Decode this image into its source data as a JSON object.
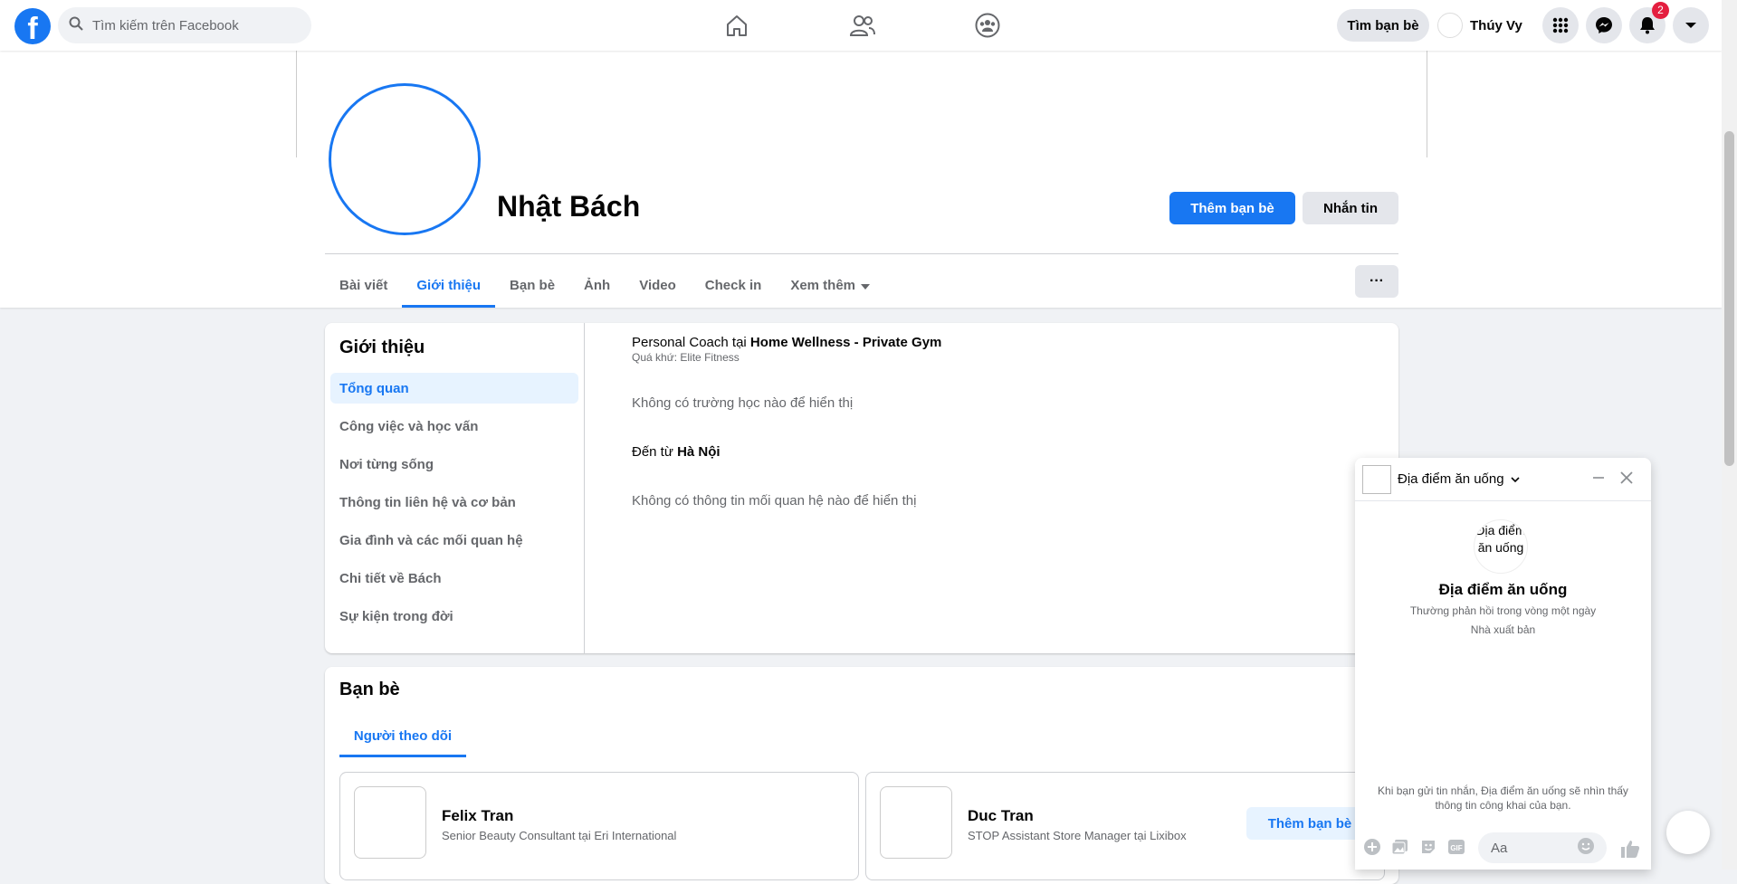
{
  "search": {
    "placeholder": "Tìm kiếm trên Facebook"
  },
  "topbar": {
    "find_friends": "Tìm bạn bè",
    "user_name": "Thúy Vy",
    "notification_count": "2"
  },
  "profile": {
    "name": "Nhật Bách",
    "add_friend": "Thêm bạn bè",
    "message": "Nhắn tin",
    "more": "···"
  },
  "tabs": [
    {
      "label": "Bài viết"
    },
    {
      "label": "Giới thiệu",
      "active": true
    },
    {
      "label": "Bạn bè"
    },
    {
      "label": "Ảnh"
    },
    {
      "label": "Video"
    },
    {
      "label": "Check in"
    },
    {
      "label": "Xem thêm"
    }
  ],
  "about": {
    "title": "Giới thiệu",
    "menu": [
      "Tổng quan",
      "Công việc và học vấn",
      "Nơi từng sống",
      "Thông tin liên hệ và cơ bản",
      "Gia đình và các mối quan hệ",
      "Chi tiết về Bách",
      "Sự kiện trong đời"
    ],
    "work_role": "Personal Coach tại ",
    "work_place": "Home Wellness - Private Gym",
    "work_past": "Quá khứ: Elite Fitness",
    "no_school": "Không có trường học nào để hiển thị",
    "from_label": "Đến từ ",
    "from_place": "Hà Nội",
    "no_relationship": "Không có thông tin mối quan hệ nào để hiển thị"
  },
  "friends": {
    "title": "Bạn bè",
    "tab": "Người theo dõi",
    "items": [
      {
        "name": "Felix Tran",
        "subtitle": "Senior Beauty Consultant tại Eri International"
      },
      {
        "name": "Duc Tran",
        "subtitle": "STOP Assistant Store Manager tại Lixibox",
        "button": "Thêm bạn bè"
      }
    ]
  },
  "chat": {
    "name": "Địa điểm ăn uống",
    "avatar_alt": "Địa điểm ăn uống",
    "title": "Địa điểm ăn uống",
    "response": "Thường phản hồi trong vòng một ngày",
    "role": "Nhà xuất bản",
    "notice": "Khi bạn gửi tin nhắn, Địa điểm ăn uống sẽ nhìn thấy thông tin công khai của bạn.",
    "input_placeholder": "Aa",
    "gif": "GIF"
  },
  "colors": {
    "accent": "#1877f2",
    "badge": "#e41e3f",
    "background": "#f0f2f5"
  }
}
